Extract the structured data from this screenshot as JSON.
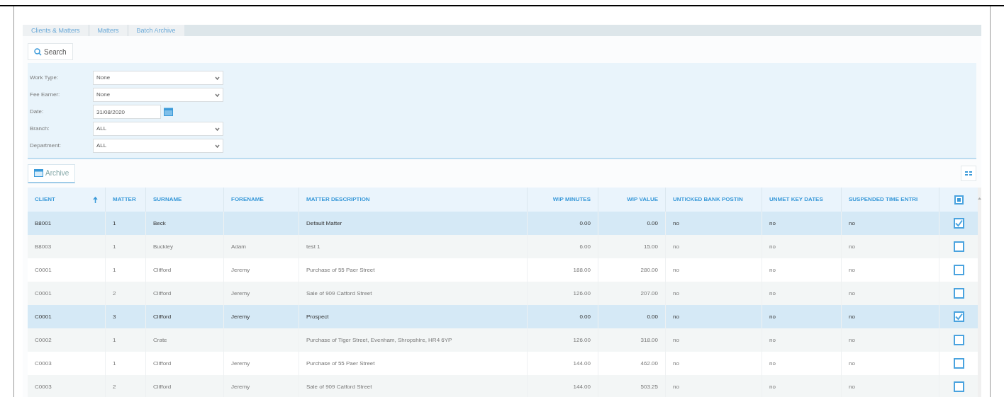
{
  "breadcrumbs": [
    {
      "label": "Clients & Matters"
    },
    {
      "label": "Matters"
    },
    {
      "label": "Batch Archive"
    }
  ],
  "search_button": {
    "label": "Search"
  },
  "filters": [
    {
      "label": "Work Type:",
      "kind": "select",
      "value": "None"
    },
    {
      "label": "Fee Earner:",
      "kind": "select",
      "value": "None"
    },
    {
      "label": "Date:",
      "kind": "date",
      "value": "31/08/2020"
    },
    {
      "label": "Branch:",
      "kind": "select",
      "value": "ALL"
    },
    {
      "label": "Department:",
      "kind": "select",
      "value": "ALL"
    }
  ],
  "archive_button": {
    "label": "Archive"
  },
  "table": {
    "columns": [
      {
        "label": "CLIENT",
        "sorted": true
      },
      {
        "label": "MATTER",
        "sorted": false
      },
      {
        "label": "SURNAME",
        "sorted": false
      },
      {
        "label": "FORENAME",
        "sorted": false
      },
      {
        "label": "MATTER DESCRIPTION",
        "sorted": false
      },
      {
        "label": "WIP MINUTES",
        "sorted": false
      },
      {
        "label": "WIP VALUE",
        "sorted": false
      },
      {
        "label": "UNTICKED BANK POSTIN",
        "sorted": false
      },
      {
        "label": "UNMET KEY DATES",
        "sorted": false
      },
      {
        "label": "SUSPENDED TIME ENTRI",
        "sorted": false
      }
    ],
    "select_all": {
      "indeterminate": true
    },
    "rows": [
      {
        "cells": [
          "B8001",
          "1",
          "Beck",
          "",
          "Default Matter",
          "0.00",
          "0.00",
          "no",
          "no",
          "no"
        ],
        "selected": true,
        "checked": true
      },
      {
        "cells": [
          "B8003",
          "1",
          "Buckley",
          "Adam",
          "test 1",
          "6.00",
          "15.00",
          "no",
          "no",
          "no"
        ],
        "selected": false,
        "checked": false
      },
      {
        "cells": [
          "C0001",
          "1",
          "Clifford",
          "Jeremy",
          "Purchase of 55 Paer Street",
          "188.00",
          "280.00",
          "no",
          "no",
          "no"
        ],
        "selected": false,
        "checked": false
      },
      {
        "cells": [
          "C0001",
          "2",
          "Clifford",
          "Jeremy",
          "Sale of 909 Catford Street",
          "126.00",
          "207.00",
          "no",
          "no",
          "no"
        ],
        "selected": false,
        "checked": false
      },
      {
        "cells": [
          "C0001",
          "3",
          "Clifford",
          "Jeremy",
          "Prospect",
          "0.00",
          "0.00",
          "no",
          "no",
          "no"
        ],
        "selected": true,
        "checked": true
      },
      {
        "cells": [
          "C0002",
          "1",
          "Crate",
          "",
          "Purchase of Tiger Street, Evenham, Shropshire, HR4 6YP",
          "126.00",
          "318.00",
          "no",
          "no",
          "no"
        ],
        "selected": false,
        "checked": false
      },
      {
        "cells": [
          "C0003",
          "1",
          "Clifford",
          "Jeremy",
          "Purchase of 55 Paer Street",
          "144.00",
          "462.00",
          "no",
          "no",
          "no"
        ],
        "selected": false,
        "checked": false
      },
      {
        "cells": [
          "C0003",
          "2",
          "Clifford",
          "Jeremy",
          "Sale of 909 Catford Street",
          "144.00",
          "503.25",
          "no",
          "no",
          "no"
        ],
        "selected": false,
        "checked": false
      }
    ]
  }
}
